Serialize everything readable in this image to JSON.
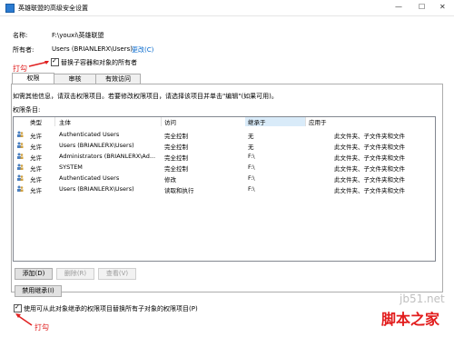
{
  "window": {
    "title": "英雄联盟的高级安全设置"
  },
  "info": {
    "name_label": "名称:",
    "name_value": "F:\\youxi\\英雄联盟",
    "owner_label": "所有者:",
    "owner_value": "Users (BRIANLERX\\Users)",
    "change_link": "更改(C)",
    "replace_owner_checkbox": "替换子容器和对象的所有者"
  },
  "annotations": {
    "top": "打勾",
    "bottom": "打勾"
  },
  "tabs": [
    {
      "label": "权限",
      "active": true
    },
    {
      "label": "审核",
      "active": false
    },
    {
      "label": "有效访问",
      "active": false
    }
  ],
  "instructions": "如需其他信息，请双击权限项目。若要修改权限项目，请选择该项目并单击\"编辑\"(如果可用)。",
  "entries_label": "权限条目:",
  "table": {
    "headers": [
      "类型",
      "主体",
      "访问",
      "继承于",
      "应用于"
    ],
    "rows": [
      [
        "允许",
        "Authenticated Users",
        "完全控制",
        "无",
        "此文件夹、子文件夹和文件"
      ],
      [
        "允许",
        "Users (BRIANLERX\\Users)",
        "完全控制",
        "无",
        "此文件夹、子文件夹和文件"
      ],
      [
        "允许",
        "Administrators (BRIANLERX\\Ad...",
        "完全控制",
        "F:\\",
        "此文件夹、子文件夹和文件"
      ],
      [
        "允许",
        "SYSTEM",
        "完全控制",
        "F:\\",
        "此文件夹、子文件夹和文件"
      ],
      [
        "允许",
        "Authenticated Users",
        "修改",
        "F:\\",
        "此文件夹、子文件夹和文件"
      ],
      [
        "允许",
        "Users (BRIANLERX\\Users)",
        "读取和执行",
        "F:\\",
        "此文件夹、子文件夹和文件"
      ]
    ]
  },
  "buttons": {
    "add": "添加(D)",
    "remove": "删除(R)",
    "view": "查看(V)",
    "disable_inheritance": "禁用继承(I)"
  },
  "replace_child_checkbox": "使用可从此对象继承的权限项目替换所有子对象的权限项目(P)",
  "watermark": {
    "text1": "脚本之家",
    "text2": "jb51.net"
  }
}
